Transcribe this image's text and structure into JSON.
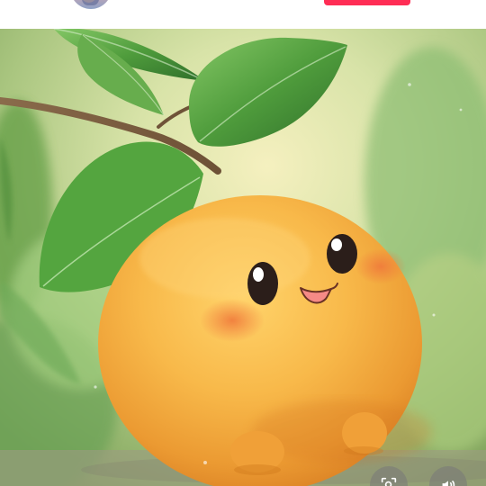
{
  "icons": {
    "avatar": "avatar",
    "follow": "follow-button",
    "scan": "scan-image-icon",
    "sound": "volume-icon"
  },
  "colors": {
    "follow_button": "#ff2d55",
    "peach_body": "#f2a23c",
    "leaf": "#4f9c3c",
    "background_blur": "#b8cf86",
    "control_button_bg": "rgba(120,120,120,0.55)"
  },
  "controls": {
    "scan_label": "",
    "sound_label": ""
  }
}
